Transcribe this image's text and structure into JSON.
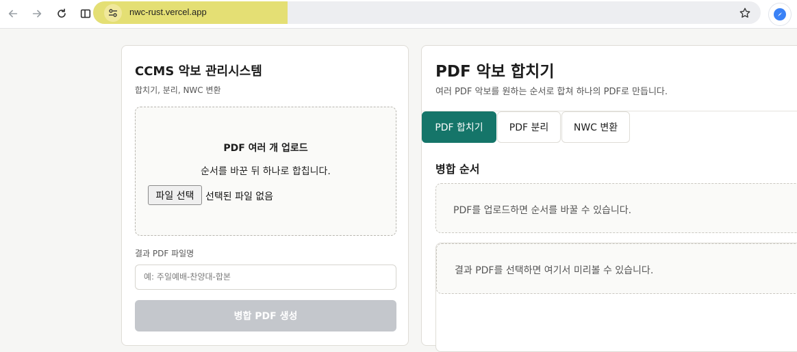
{
  "browser": {
    "url": "nwc-rust.vercel.app"
  },
  "left_card": {
    "title": "CCMS 악보 관리시스템",
    "subtitle": "합치기, 분리, NWC 변환",
    "dropzone": {
      "title": "PDF 여러 개 업로드",
      "description": "순서를 바꾼 뒤 하나로 합칩니다.",
      "file_button": "파일 선택",
      "file_status": "선택된 파일 없음"
    },
    "result_label": "결과 PDF 파일명",
    "result_placeholder": "예: 주일예배-찬양대-합본",
    "merge_button": "병합 PDF 생성"
  },
  "right_card": {
    "title": "PDF 악보 합치기",
    "subtitle": "여러 PDF 악보를 원하는 순서로 합쳐 하나의 PDF로 만듭니다.",
    "tabs": [
      {
        "label": "PDF 합치기",
        "active": true
      },
      {
        "label": "PDF 분리",
        "active": false
      },
      {
        "label": "NWC 변환",
        "active": false
      }
    ],
    "section_title": "병합 순서",
    "order_placeholder": "PDF를 업로드하면 순서를 바꿀 수 있습니다.",
    "preview_placeholder": "결과 PDF를 선택하면 여기서 미리볼 수 있습니다."
  },
  "colors": {
    "accent": "#157569",
    "disabled_button": "#c4c7cc",
    "url_highlight": "#e4df74"
  }
}
